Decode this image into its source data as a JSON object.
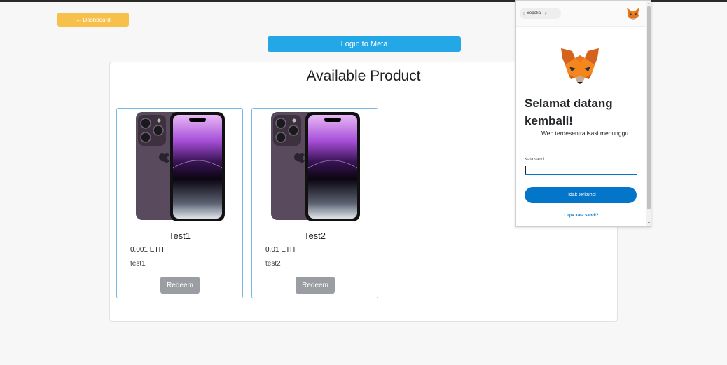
{
  "header": {
    "back_label": "← Dashboard",
    "login_label": "Login to Meta"
  },
  "panel": {
    "title": "Available Product"
  },
  "products": [
    {
      "name": "Test1",
      "price": "0.001 ETH",
      "description": "test1",
      "redeem_label": "Redeem"
    },
    {
      "name": "Test2",
      "price": "0.01 ETH",
      "description": "test2",
      "redeem_label": "Redeem"
    }
  ],
  "metamask": {
    "network": "Sepolia",
    "title": "Selamat datang kembali!",
    "subtitle": "Web terdesentralisasi menunggu",
    "password_label": "Kata sandi",
    "password_value": "",
    "unlock_label": "Tidak terkunci",
    "forgot_label": "Lupa kata sandi?"
  },
  "colors": {
    "dashboard_button": "#f7c04a",
    "login_button": "#23a7e6",
    "redeem_button": "#9a9ea3",
    "metamask_primary": "#0376c9",
    "card_border": "#7ab8e4"
  },
  "icons": [
    "arrow-left-icon",
    "phone-image",
    "metamask-fox-icon",
    "network-dot-icon",
    "chevron-down-icon"
  ]
}
